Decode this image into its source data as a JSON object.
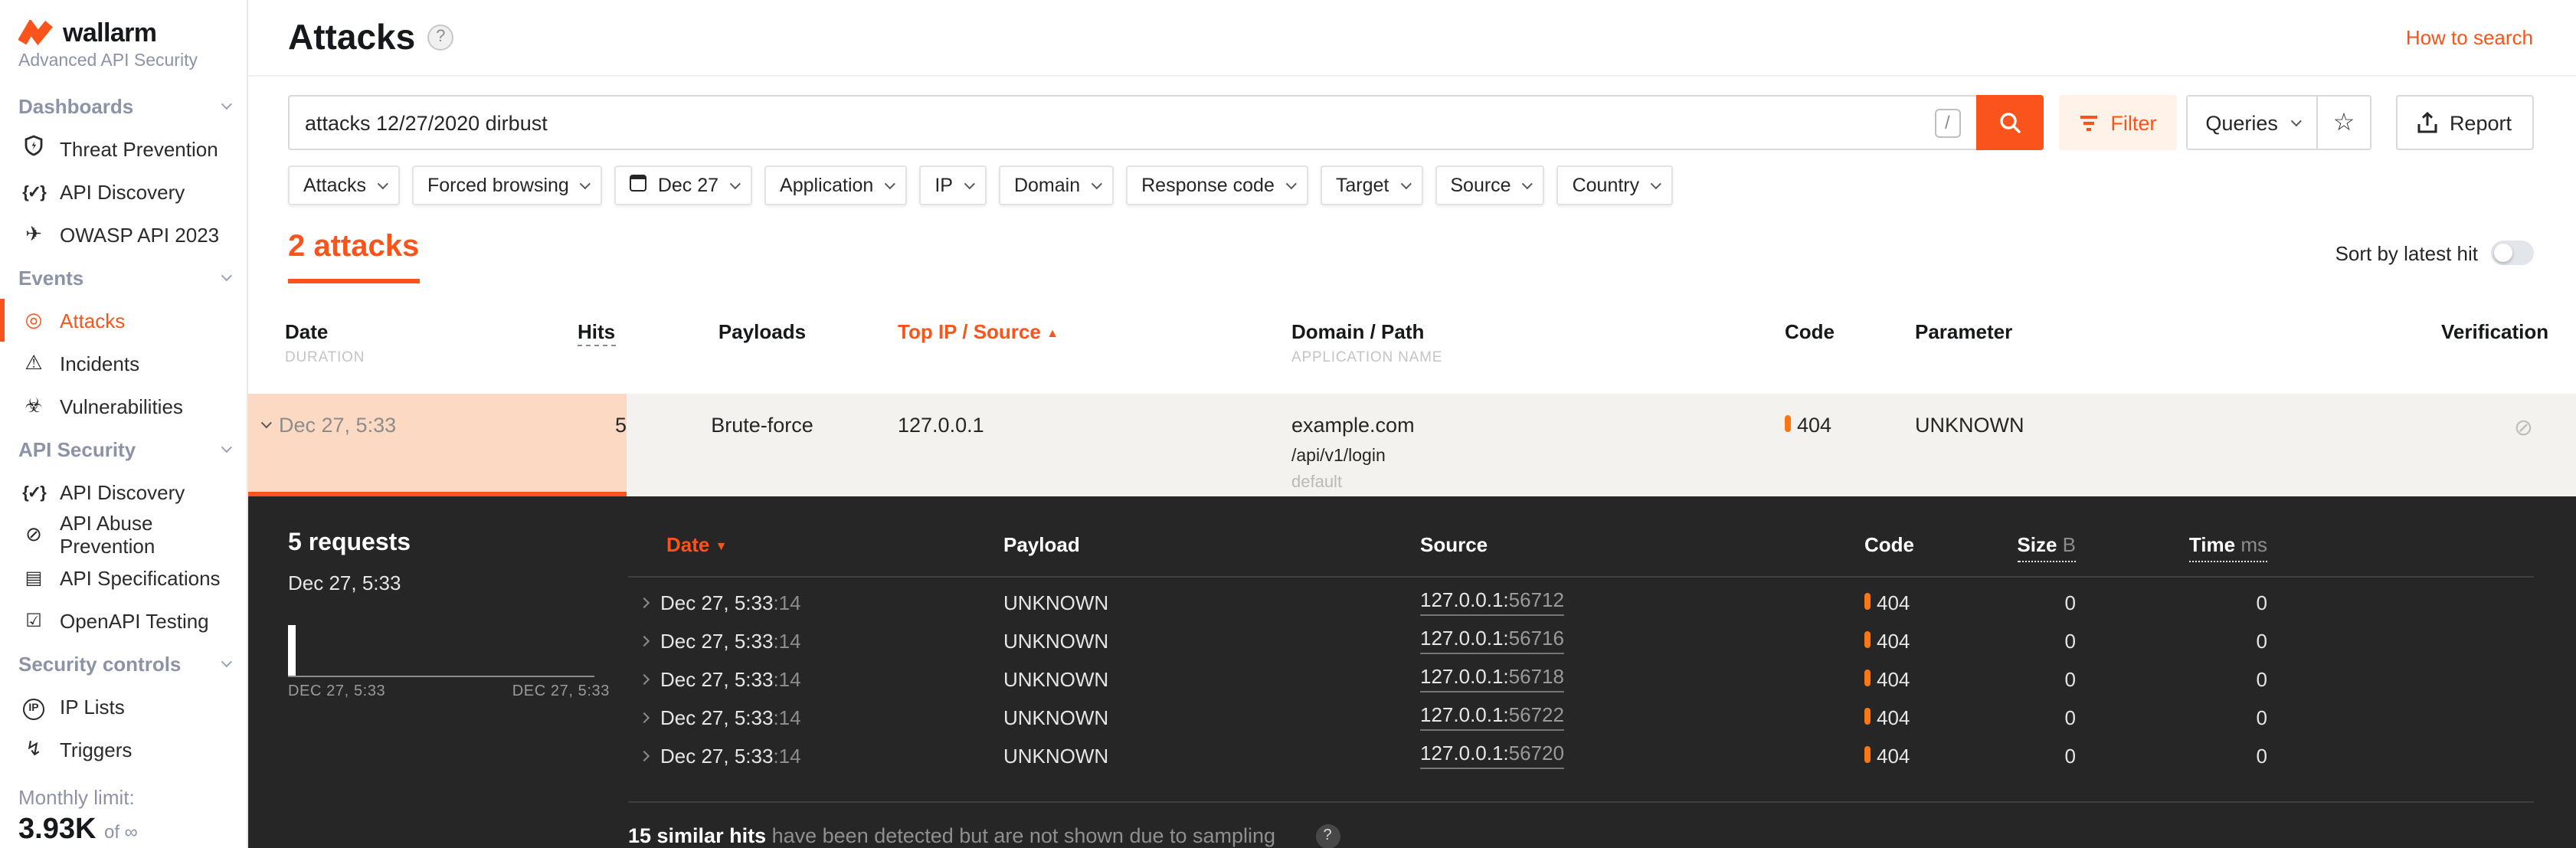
{
  "colors": {
    "accent": "#fa541c",
    "accent_light_bg": "#fff2e8",
    "row_highlight": "#fbd9c3",
    "row_bg": "#f4f2ee",
    "panel_dark": "#262626",
    "code_flag": "#fa7714"
  },
  "brand": {
    "name": "wallarm",
    "subtitle": "Advanced API Security",
    "logo_icon": "wallarm-zigzag-icon"
  },
  "sidebar": {
    "sections": [
      {
        "label": "Dashboards",
        "items": [
          {
            "icon": "shield-icon",
            "label": "Threat Prevention",
            "active": false
          },
          {
            "icon": "braces-check-icon",
            "label": "API Discovery",
            "active": false
          },
          {
            "icon": "paper-plane-icon",
            "label": "OWASP API 2023",
            "active": false
          }
        ]
      },
      {
        "label": "Events",
        "items": [
          {
            "icon": "target-icon",
            "label": "Attacks",
            "active": true
          },
          {
            "icon": "warning-triangle-icon",
            "label": "Incidents",
            "active": false
          },
          {
            "icon": "biohazard-icon",
            "label": "Vulnerabilities",
            "active": false
          }
        ]
      },
      {
        "label": "API Security",
        "items": [
          {
            "icon": "braces-check-icon",
            "label": "API Discovery",
            "active": false
          },
          {
            "icon": "bot-blocked-icon",
            "label": "API Abuse Prevention",
            "active": false
          },
          {
            "icon": "document-icon",
            "label": "API Specifications",
            "active": false
          },
          {
            "icon": "checkbox-icon",
            "label": "OpenAPI Testing",
            "active": false
          }
        ]
      },
      {
        "label": "Security controls",
        "items": [
          {
            "icon": "ip-circle-icon",
            "label": "IP Lists",
            "active": false
          },
          {
            "icon": "bolt-icon",
            "label": "Triggers",
            "active": false
          }
        ]
      }
    ],
    "monthly_limit_label": "Monthly limit:",
    "monthly_limit_value": "3.93K",
    "monthly_limit_suffix": "of ∞"
  },
  "header": {
    "title": "Attacks",
    "help": "?",
    "how_to_search": "How to search"
  },
  "toolbar": {
    "search_value": "attacks 12/27/2020 dirbust",
    "search_shortcut": "/",
    "filter_label": "Filter",
    "queries_label": "Queries",
    "star_icon": "☆",
    "report_label": "Report"
  },
  "filters": [
    {
      "label": "Attacks",
      "icon": null
    },
    {
      "label": "Forced browsing",
      "icon": null
    },
    {
      "label": "Dec 27",
      "icon": "calendar-icon"
    },
    {
      "label": "Application",
      "icon": null
    },
    {
      "label": "IP",
      "icon": null
    },
    {
      "label": "Domain",
      "icon": null
    },
    {
      "label": "Response code",
      "icon": null
    },
    {
      "label": "Target",
      "icon": null
    },
    {
      "label": "Source",
      "icon": null
    },
    {
      "label": "Country",
      "icon": null
    }
  ],
  "results": {
    "count_label": "2 attacks",
    "sort_label": "Sort by latest hit",
    "sort_on": false
  },
  "attacks_table": {
    "headers": {
      "date": "Date",
      "duration": "DURATION",
      "hits": "Hits",
      "payloads": "Payloads",
      "top_ip": "Top IP / Source",
      "sort_asc": "▲",
      "domain": "Domain / Path",
      "app_name": "APPLICATION NAME",
      "code": "Code",
      "parameter": "Parameter",
      "verification": "Verification"
    },
    "row": {
      "date": "Dec 27, 5:33",
      "hits": "5",
      "payload": "Brute-force",
      "top_ip": "127.0.0.1",
      "domain": "example.com",
      "path": "/api/v1/login",
      "application": "default",
      "code": "404",
      "parameter": "UNKNOWN",
      "verification_icon": "⊘"
    }
  },
  "details": {
    "requests_count": "5 requests",
    "time": "Dec 27, 5:33",
    "chart": {
      "bar_count": 1,
      "start_label": "DEC 27, 5:33",
      "end_label": "DEC 27, 5:33"
    },
    "headers": {
      "date": "Date",
      "sort_desc": "▼",
      "payload": "Payload",
      "source": "Source",
      "code": "Code",
      "size": "Size",
      "size_unit": "B",
      "time": "Time",
      "time_unit": "ms"
    },
    "rows": [
      {
        "date": "Dec 27, 5:33",
        "seconds": ":14",
        "payload": "UNKNOWN",
        "ip": "127.0.0.1:",
        "port": "56712",
        "code": "404",
        "size": "0",
        "time": "0"
      },
      {
        "date": "Dec 27, 5:33",
        "seconds": ":14",
        "payload": "UNKNOWN",
        "ip": "127.0.0.1:",
        "port": "56716",
        "code": "404",
        "size": "0",
        "time": "0"
      },
      {
        "date": "Dec 27, 5:33",
        "seconds": ":14",
        "payload": "UNKNOWN",
        "ip": "127.0.0.1:",
        "port": "56718",
        "code": "404",
        "size": "0",
        "time": "0"
      },
      {
        "date": "Dec 27, 5:33",
        "seconds": ":14",
        "payload": "UNKNOWN",
        "ip": "127.0.0.1:",
        "port": "56722",
        "code": "404",
        "size": "0",
        "time": "0"
      },
      {
        "date": "Dec 27, 5:33",
        "seconds": ":14",
        "payload": "UNKNOWN",
        "ip": "127.0.0.1:",
        "port": "56720",
        "code": "404",
        "size": "0",
        "time": "0"
      }
    ],
    "sampling": {
      "strong": "15 similar hits",
      "rest": " have been detected but are not shown due to sampling",
      "help": "?"
    }
  }
}
